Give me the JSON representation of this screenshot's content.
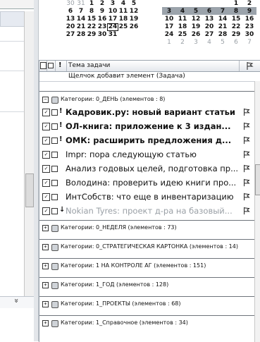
{
  "calendar": {
    "left_month": {
      "rows": [
        [
          {
            "d": "30",
            "dim": true
          },
          {
            "d": "31",
            "dim": true
          },
          {
            "d": "1"
          },
          {
            "d": "2"
          },
          {
            "d": "3"
          },
          {
            "d": "4"
          },
          {
            "d": "5"
          }
        ],
        [
          {
            "d": "6"
          },
          {
            "d": "7"
          },
          {
            "d": "8"
          },
          {
            "d": "9"
          },
          {
            "d": "10"
          },
          {
            "d": "11"
          },
          {
            "d": "12"
          }
        ],
        [
          {
            "d": "13"
          },
          {
            "d": "14"
          },
          {
            "d": "15"
          },
          {
            "d": "16"
          },
          {
            "d": "17"
          },
          {
            "d": "18"
          },
          {
            "d": "19"
          }
        ],
        [
          {
            "d": "20"
          },
          {
            "d": "21"
          },
          {
            "d": "22"
          },
          {
            "d": "23"
          },
          {
            "d": "24",
            "today": true
          },
          {
            "d": "25"
          },
          {
            "d": "26"
          }
        ],
        [
          {
            "d": "27"
          },
          {
            "d": "28"
          },
          {
            "d": "29"
          },
          {
            "d": "30"
          },
          {
            "d": "31"
          }
        ]
      ]
    },
    "right_month": {
      "rows": [
        [
          {
            "d": "1"
          },
          {
            "d": "2"
          }
        ],
        [
          {
            "d": "3"
          },
          {
            "d": "4"
          },
          {
            "d": "5"
          },
          {
            "d": "6"
          },
          {
            "d": "7"
          },
          {
            "d": "8"
          },
          {
            "d": "9"
          }
        ],
        [
          {
            "d": "10"
          },
          {
            "d": "11"
          },
          {
            "d": "12"
          },
          {
            "d": "13"
          },
          {
            "d": "14"
          },
          {
            "d": "15"
          },
          {
            "d": "16"
          }
        ],
        [
          {
            "d": "17"
          },
          {
            "d": "18"
          },
          {
            "d": "19"
          },
          {
            "d": "20"
          },
          {
            "d": "21"
          },
          {
            "d": "22"
          },
          {
            "d": "23"
          }
        ],
        [
          {
            "d": "24"
          },
          {
            "d": "25"
          },
          {
            "d": "26"
          },
          {
            "d": "27"
          },
          {
            "d": "28"
          },
          {
            "d": "29"
          },
          {
            "d": "30"
          }
        ],
        [
          {
            "d": "1",
            "dim": true
          },
          {
            "d": "2",
            "dim": true
          },
          {
            "d": "3",
            "dim": true
          },
          {
            "d": "4",
            "dim": true
          },
          {
            "d": "5",
            "dim": true
          },
          {
            "d": "6",
            "dim": true
          },
          {
            "d": "7",
            "dim": true
          }
        ]
      ]
    }
  },
  "task_list": {
    "header_title": "Тема задачи",
    "click_to_add": "Щелчок добавит элемент (Задача)",
    "group_first": {
      "label": "Категории: 0_ДЕНЬ (элементов : 8)",
      "expand": "−"
    },
    "tasks": [
      {
        "subject": "Кадровик.ру: новый вариант статьи",
        "bold": true,
        "important": true,
        "done": false
      },
      {
        "subject": "ОЛ-книга: приложение к 3 издан...",
        "bold": true,
        "important": true,
        "done": false
      },
      {
        "subject": "ОМК: расширить предложения д...",
        "bold": true,
        "important": true,
        "done": false
      },
      {
        "subject": "Impr: пора следующую статью",
        "bold": false,
        "important": false,
        "done": false
      },
      {
        "subject": "Анализ годовых целей, подготовка пр...",
        "bold": false,
        "important": false,
        "done": false
      },
      {
        "subject": "Володина: проверить идею книги про...",
        "bold": false,
        "important": false,
        "done": false
      },
      {
        "subject": "ИнтСобств: что еще в инвентаризацию",
        "bold": false,
        "important": false,
        "done": false
      },
      {
        "subject": "Nokian Tyres: проект д-ра на базовый...",
        "bold": false,
        "important": false,
        "done": true,
        "low": true
      }
    ],
    "groups": [
      {
        "label": "Категории: 0_НЕДЕЛЯ (элементов : 73)",
        "expand": "+"
      },
      {
        "label": "Категории: 0_СТРАТЕГИЧЕСКАЯ КАРТОНКА (элементов : 14)",
        "expand": "+"
      },
      {
        "label": "Категории: 1 НА КОНТРОЛЕ АГ (элементов : 151)",
        "expand": "+"
      },
      {
        "label": "Категории: 1_ГОД (элементов : 128)",
        "expand": "+"
      },
      {
        "label": "Категории: 1_ПРОЕКТЫ (элементов : 68)",
        "expand": "+"
      },
      {
        "label": "Категории: 1_Справочное (элементов : 34)",
        "expand": "+"
      }
    ],
    "icons": {
      "header_task_icon": "task-icon",
      "header_check_icon": "checkbox-icon",
      "header_importance_icon": "exclamation-icon",
      "header_flag_icon": "flag-icon",
      "low_priority_icon": "down-arrow-icon"
    }
  },
  "left_pane": {
    "bottom_chevron": "»"
  }
}
